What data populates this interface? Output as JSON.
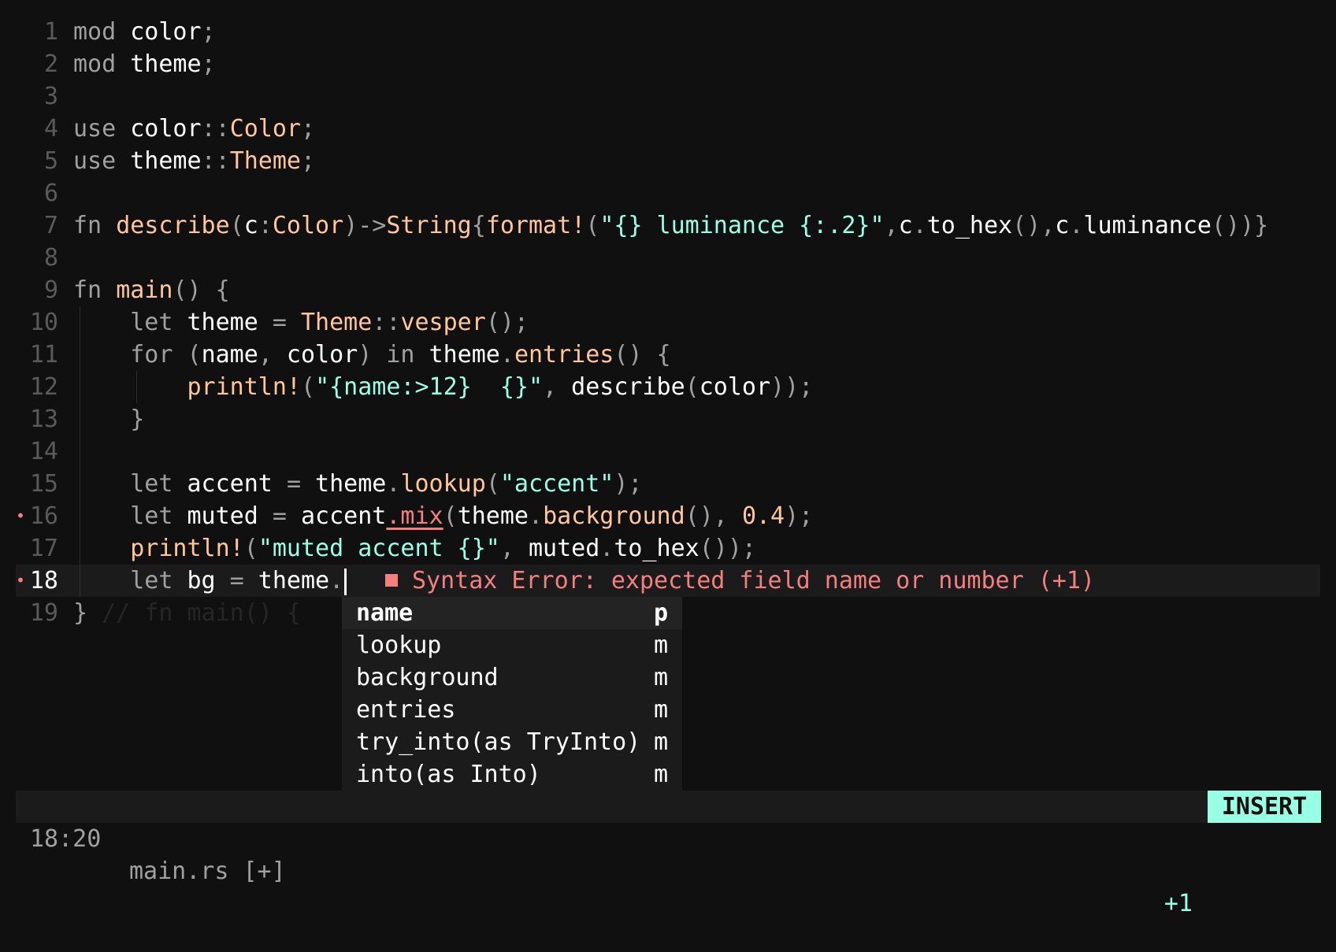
{
  "editor": {
    "lines": [
      {
        "n": "1",
        "tokens": [
          [
            "kw",
            "mod"
          ],
          [
            "id",
            " color"
          ],
          [
            "punc",
            ";"
          ]
        ]
      },
      {
        "n": "2",
        "tokens": [
          [
            "kw",
            "mod"
          ],
          [
            "id",
            " theme"
          ],
          [
            "punc",
            ";"
          ]
        ]
      },
      {
        "n": "3",
        "tokens": []
      },
      {
        "n": "4",
        "tokens": [
          [
            "kw",
            "use"
          ],
          [
            "id",
            " color"
          ],
          [
            "punc",
            "::"
          ],
          [
            "ty",
            "Color"
          ],
          [
            "punc",
            ";"
          ]
        ]
      },
      {
        "n": "5",
        "tokens": [
          [
            "kw",
            "use"
          ],
          [
            "id",
            " theme"
          ],
          [
            "punc",
            "::"
          ],
          [
            "ty",
            "Theme"
          ],
          [
            "punc",
            ";"
          ]
        ]
      },
      {
        "n": "6",
        "tokens": []
      },
      {
        "n": "7",
        "tokens": [
          [
            "kw",
            "fn "
          ],
          [
            "fn",
            "describe"
          ],
          [
            "punc",
            "("
          ],
          [
            "id",
            "c"
          ],
          [
            "punc",
            ":"
          ],
          [
            "ty",
            "Color"
          ],
          [
            "punc",
            ")->"
          ],
          [
            "ty",
            "String"
          ],
          [
            "punc",
            "{"
          ],
          [
            "fn",
            "format!"
          ],
          [
            "punc",
            "("
          ],
          [
            "str",
            "\"{} luminance {:.2}\""
          ],
          [
            "punc",
            ","
          ],
          [
            "id",
            "c"
          ],
          [
            "punc",
            "."
          ],
          [
            "id",
            "to_hex"
          ],
          [
            "punc",
            "(),"
          ],
          [
            "id",
            "c"
          ],
          [
            "punc",
            "."
          ],
          [
            "id",
            "luminance"
          ],
          [
            "punc",
            "())}"
          ]
        ]
      },
      {
        "n": "8",
        "tokens": []
      },
      {
        "n": "9",
        "tokens": [
          [
            "kw",
            "fn "
          ],
          [
            "fn",
            "main"
          ],
          [
            "punc",
            "() {"
          ]
        ]
      },
      {
        "n": "10",
        "guides": [
          1
        ],
        "tokens": [
          [
            "id",
            "    "
          ],
          [
            "kw",
            "let"
          ],
          [
            "id",
            " theme "
          ],
          [
            "punc",
            "="
          ],
          [
            "id",
            " "
          ],
          [
            "ty",
            "Theme"
          ],
          [
            "punc",
            "::"
          ],
          [
            "fn",
            "vesper"
          ],
          [
            "punc",
            "();"
          ]
        ]
      },
      {
        "n": "11",
        "guides": [
          1
        ],
        "tokens": [
          [
            "id",
            "    "
          ],
          [
            "kw",
            "for"
          ],
          [
            "punc",
            " ("
          ],
          [
            "id",
            "name"
          ],
          [
            "punc",
            ","
          ],
          [
            "id",
            " color"
          ],
          [
            "punc",
            ")"
          ],
          [
            "kw",
            " in"
          ],
          [
            "id",
            " theme"
          ],
          [
            "punc",
            "."
          ],
          [
            "fn",
            "entries"
          ],
          [
            "punc",
            "() {"
          ]
        ]
      },
      {
        "n": "12",
        "guides": [
          1,
          2
        ],
        "tokens": [
          [
            "id",
            "        "
          ],
          [
            "fn",
            "println!"
          ],
          [
            "punc",
            "("
          ],
          [
            "str",
            "\"{name:>12}  {}\""
          ],
          [
            "punc",
            ","
          ],
          [
            "id",
            " describe"
          ],
          [
            "punc",
            "("
          ],
          [
            "id",
            "color"
          ],
          [
            "punc",
            "));"
          ]
        ]
      },
      {
        "n": "13",
        "guides": [
          1
        ],
        "tokens": [
          [
            "id",
            "    "
          ],
          [
            "punc",
            "}"
          ]
        ]
      },
      {
        "n": "14",
        "guides": [
          1
        ],
        "tokens": []
      },
      {
        "n": "15",
        "guides": [
          1
        ],
        "tokens": [
          [
            "id",
            "    "
          ],
          [
            "kw",
            "let"
          ],
          [
            "id",
            " accent "
          ],
          [
            "punc",
            "="
          ],
          [
            "id",
            " theme"
          ],
          [
            "punc",
            "."
          ],
          [
            "fn",
            "lookup"
          ],
          [
            "punc",
            "("
          ],
          [
            "str",
            "\"accent\""
          ],
          [
            "punc",
            ");"
          ]
        ]
      },
      {
        "n": "16",
        "diag": true,
        "guides": [
          1
        ],
        "tokens": [
          [
            "id",
            "    "
          ],
          [
            "kw",
            "let"
          ],
          [
            "id",
            " muted "
          ],
          [
            "punc",
            "="
          ],
          [
            "id",
            " accent"
          ],
          [
            "err",
            ".mix"
          ],
          [
            "punc",
            "("
          ],
          [
            "id",
            "theme"
          ],
          [
            "punc",
            "."
          ],
          [
            "fn",
            "background"
          ],
          [
            "punc",
            "(), "
          ],
          [
            "num",
            "0.4"
          ],
          [
            "punc",
            ");"
          ]
        ]
      },
      {
        "n": "17",
        "guides": [
          1
        ],
        "tokens": [
          [
            "id",
            "    "
          ],
          [
            "fn",
            "println!"
          ],
          [
            "punc",
            "("
          ],
          [
            "str",
            "\"muted accent {}\""
          ],
          [
            "punc",
            ","
          ],
          [
            "id",
            " muted"
          ],
          [
            "punc",
            "."
          ],
          [
            "id",
            "to_hex"
          ],
          [
            "punc",
            "());"
          ]
        ]
      },
      {
        "n": "18",
        "current": true,
        "diag": true,
        "guides": [
          1
        ],
        "tokens": [
          [
            "id",
            "    "
          ],
          [
            "kw",
            "let"
          ],
          [
            "id",
            " bg "
          ],
          [
            "punc",
            "="
          ],
          [
            "id",
            " theme"
          ],
          [
            "punc",
            "."
          ]
        ]
      },
      {
        "n": "19",
        "tokens": [
          [
            "punc",
            "}"
          ],
          [
            "cm",
            " // fn main() {"
          ]
        ]
      }
    ],
    "inline_diagnostic": "Syntax Error: expected field name or number (+1)"
  },
  "completion": {
    "items": [
      {
        "label": "name",
        "kind": "p",
        "selected": true
      },
      {
        "label": "lookup",
        "kind": "m"
      },
      {
        "label": "background",
        "kind": "m"
      },
      {
        "label": "entries",
        "kind": "m"
      },
      {
        "label": "try_into(as TryInto)",
        "kind": "m"
      },
      {
        "label": "into(as Into)",
        "kind": "m"
      }
    ]
  },
  "statusbar": {
    "position": "18:20",
    "file": "main.rs [+]",
    "diagnostics": "+1",
    "mode": "INSERT"
  },
  "colors": {
    "background": "#101010",
    "accent": "#99ffe4",
    "function": "#ffc799",
    "error": "#f47f7f",
    "muted": "#a0a0a0"
  }
}
